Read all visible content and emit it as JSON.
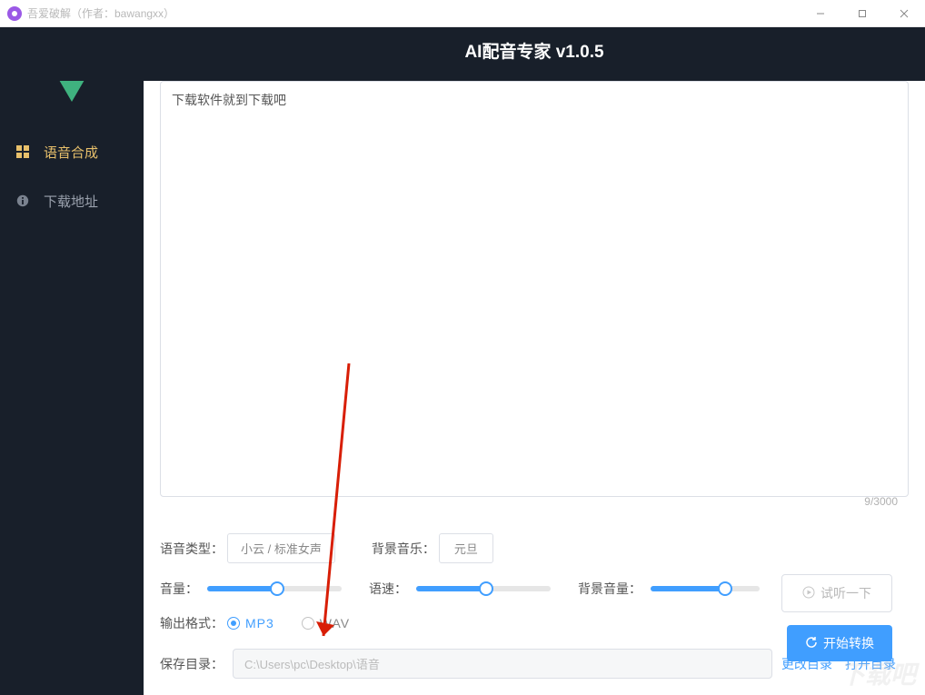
{
  "window": {
    "title": "吾爱破解（作者：bawangxx）"
  },
  "header": {
    "title": "AI配音专家 v1.0.5"
  },
  "sidebar": {
    "items": [
      {
        "label": "语音合成"
      },
      {
        "label": "下载地址"
      }
    ]
  },
  "editor": {
    "text": "下载软件就到下载吧",
    "counter": "9/3000"
  },
  "controls": {
    "voice_type_label": "语音类型：",
    "voice_type_value": "小云 / 标准女声",
    "bg_music_label": "背景音乐：",
    "bg_music_value": "元旦",
    "volume_label": "音量：",
    "speed_label": "语速：",
    "bg_volume_label": "背景音量：",
    "volume_pct": 52,
    "speed_pct": 52,
    "bg_volume_pct": 68,
    "output_format_label": "输出格式：",
    "format_mp3": "MP3",
    "format_wav": "WAV",
    "save_dir_label": "保存目录：",
    "save_dir_value": "C:\\Users\\pc\\Desktop\\语音",
    "change_dir": "更改目录",
    "open_dir": "打开目录",
    "preview": "试听一下",
    "start": "开始转换"
  },
  "watermark": "下载吧"
}
